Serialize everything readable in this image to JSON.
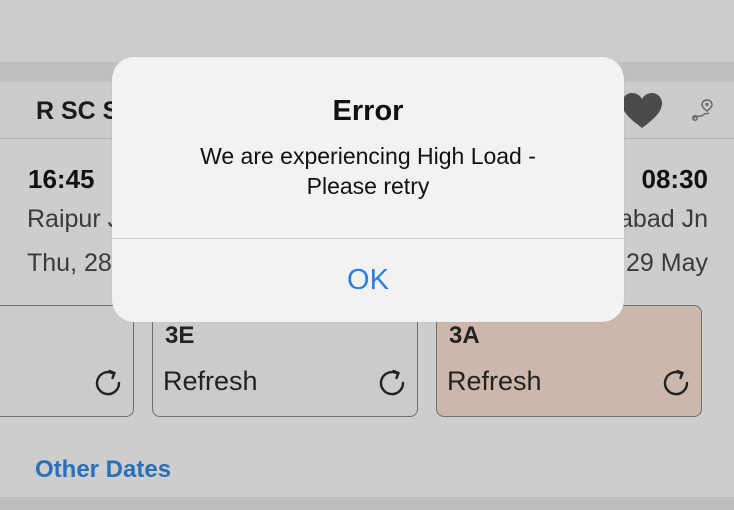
{
  "train": {
    "name": "R SC S",
    "heart_icon": "heart-icon",
    "route_icon": "route-pin-icon"
  },
  "journey": {
    "departure_time": "16:45",
    "arrival_time": "08:30",
    "departure_station": "Raipur J",
    "arrival_station": "abad Jn",
    "departure_date": "Thu, 28",
    "arrival_date": "29 May"
  },
  "classes": [
    {
      "code": "",
      "status": ""
    },
    {
      "code": "3E",
      "status": "Refresh"
    },
    {
      "code": "3A",
      "status": "Refresh"
    }
  ],
  "links": {
    "other_dates": "Other Dates"
  },
  "dialog": {
    "title": "Error",
    "message_line1": "We are experiencing High Load -",
    "message_line2": "Please retry",
    "ok_label": "OK"
  },
  "colors": {
    "accent_blue": "#2f7fe0",
    "link_blue": "#2a6fba",
    "selected_class_bg": "#cdb7ab"
  }
}
